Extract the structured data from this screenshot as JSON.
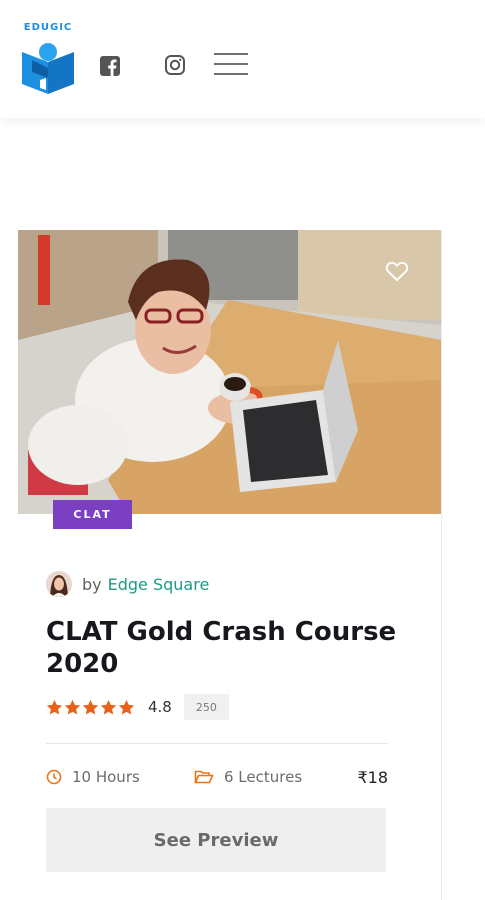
{
  "header": {
    "logo_text": "EDUGIC",
    "icons": {
      "facebook": "facebook-icon",
      "instagram": "instagram-icon",
      "menu": "hamburger-menu-icon"
    }
  },
  "course": {
    "category_badge": "CLAT",
    "by_label": "by",
    "author_name": "Edge Square",
    "title": "CLAT Gold Crash Course 2020",
    "rating_value": "4.8",
    "rating_count": "250",
    "stars": 5,
    "duration": "10 Hours",
    "lectures": "6 Lectures",
    "price": "₹18",
    "preview_button": "See Preview"
  },
  "colors": {
    "badge": "#7b3fc4",
    "author_link": "#1c9a85",
    "star": "#e8621b",
    "meta_icon": "#e8751a",
    "logo_blue": "#1c8fe0"
  }
}
